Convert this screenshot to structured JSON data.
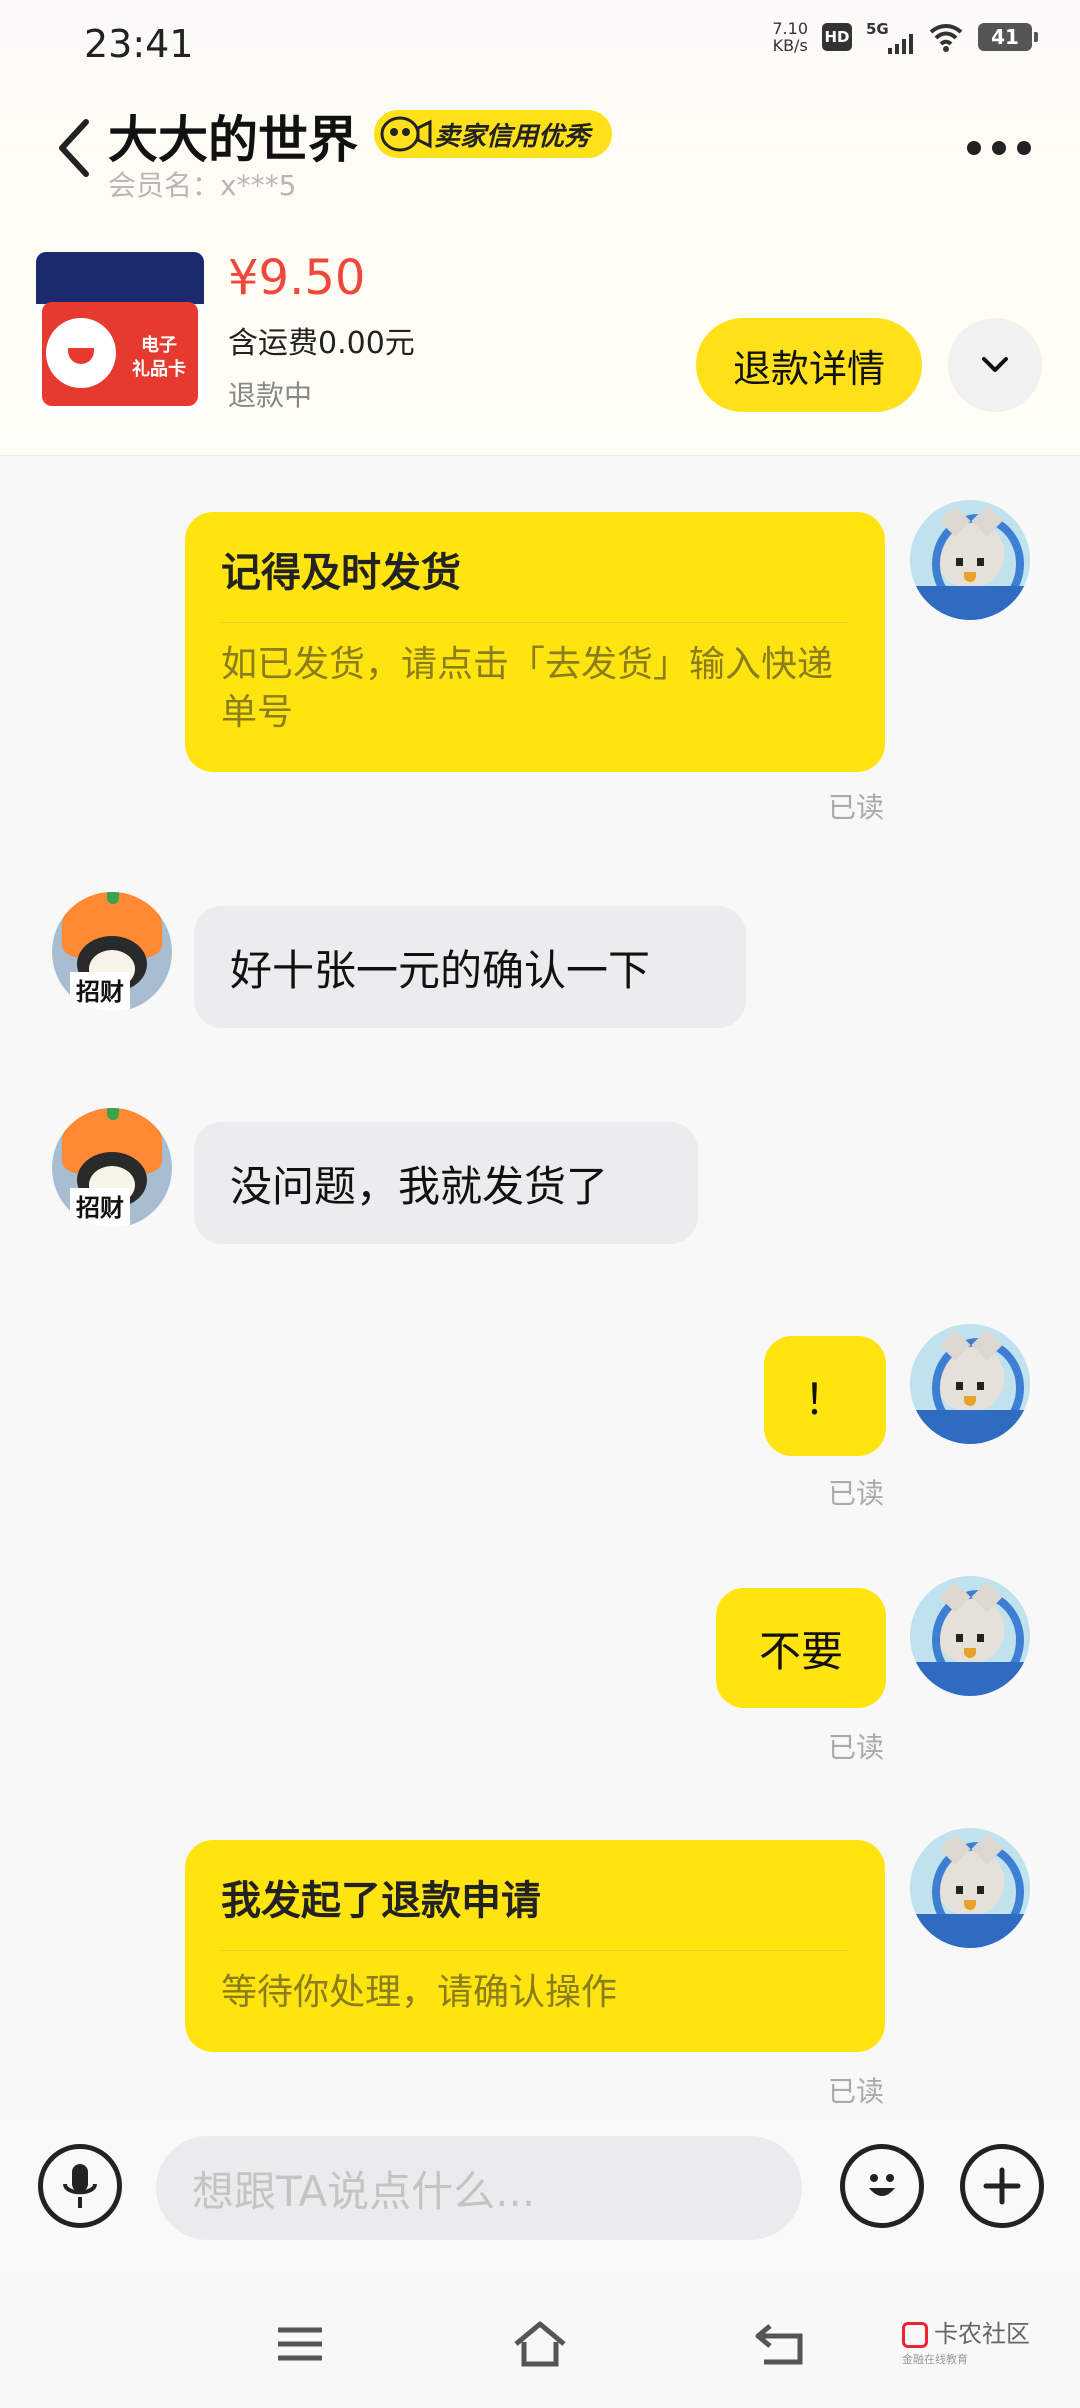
{
  "status_bar": {
    "time": "23:41",
    "net_speed_top": "7.10",
    "net_speed_unit": "KB/s",
    "hd": "HD",
    "network": "5G",
    "battery": "41"
  },
  "header": {
    "shop_name": "大大的世界",
    "credit_badge": "卖家信用优秀",
    "member_label": "会员名：x***5"
  },
  "product": {
    "thumb_caption": "电子\n礼品卡",
    "price": "¥9.50",
    "shipping": "含运费0.00元",
    "status": "退款中",
    "refund_button": "退款详情"
  },
  "messages": {
    "m1": {
      "title": "记得及时发货",
      "desc": "如已发货，请点击「去发货」输入快递单号",
      "read": "已读"
    },
    "m2": {
      "text": "好十张一元的确认一下"
    },
    "m3": {
      "text": "没问题，我就发货了"
    },
    "m4": {
      "text": "！",
      "read": "已读"
    },
    "m5": {
      "text": "不要",
      "read": "已读"
    },
    "m6": {
      "title": "我发起了退款申请",
      "desc": "等待你处理，请确认操作",
      "read": "已读"
    }
  },
  "input": {
    "placeholder": "想跟TA说点什么..."
  },
  "watermark": {
    "text": "卡农社区",
    "sub": "金融在线教育"
  },
  "colors": {
    "accent_yellow": "#ffe40f",
    "price_red": "#f0473c",
    "incoming_bubble": "#ececef"
  }
}
